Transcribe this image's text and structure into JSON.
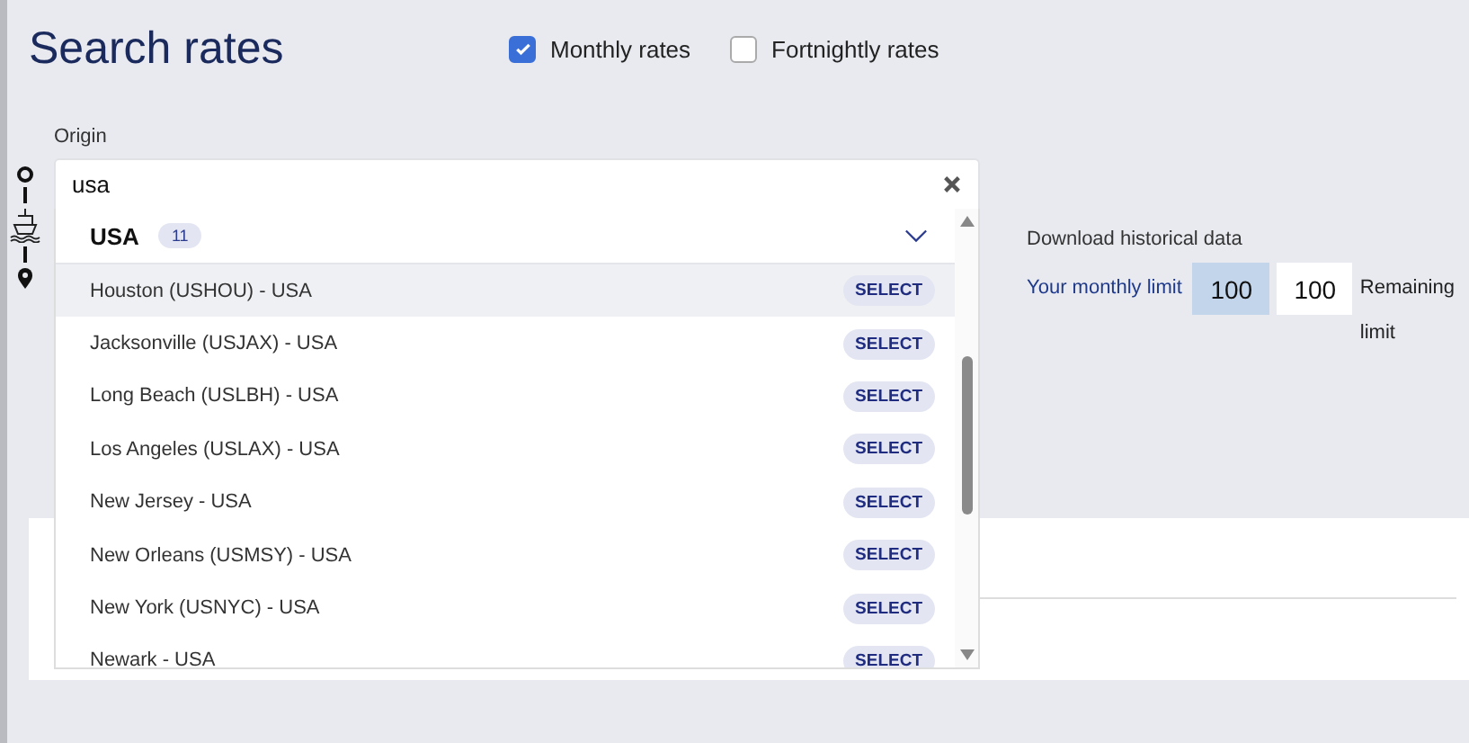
{
  "title": "Search rates",
  "rate_options": [
    {
      "label": "Monthly rates",
      "checked": true
    },
    {
      "label": "Fortnightly rates",
      "checked": false
    }
  ],
  "origin": {
    "label": "Origin",
    "value": "usa"
  },
  "dropdown": {
    "group": {
      "name": "USA",
      "count": "11",
      "expanded": true
    },
    "items": [
      {
        "name": "Houston (USHOU) - USA",
        "action": "SELECT",
        "highlighted": true
      },
      {
        "name": "Jacksonville (USJAX) - USA",
        "action": "SELECT",
        "highlighted": false
      },
      {
        "name": "Long Beach (USLBH) - USA",
        "action": "SELECT",
        "highlighted": false
      },
      {
        "name": "Los Angeles (USLAX) - USA",
        "action": "SELECT",
        "highlighted": false
      },
      {
        "name": "New Jersey - USA",
        "action": "SELECT",
        "highlighted": false
      },
      {
        "name": "New Orleans (USMSY) - USA",
        "action": "SELECT",
        "highlighted": false
      },
      {
        "name": "New York (USNYC) - USA",
        "action": "SELECT",
        "highlighted": false
      },
      {
        "name": "Newark - USA",
        "action": "SELECT",
        "highlighted": false
      }
    ]
  },
  "download": {
    "title": "Download historical data",
    "monthly_label": "Your monthly limit",
    "monthly_value": "100",
    "remaining_value": "100",
    "remaining_label": "Remaining limit"
  }
}
